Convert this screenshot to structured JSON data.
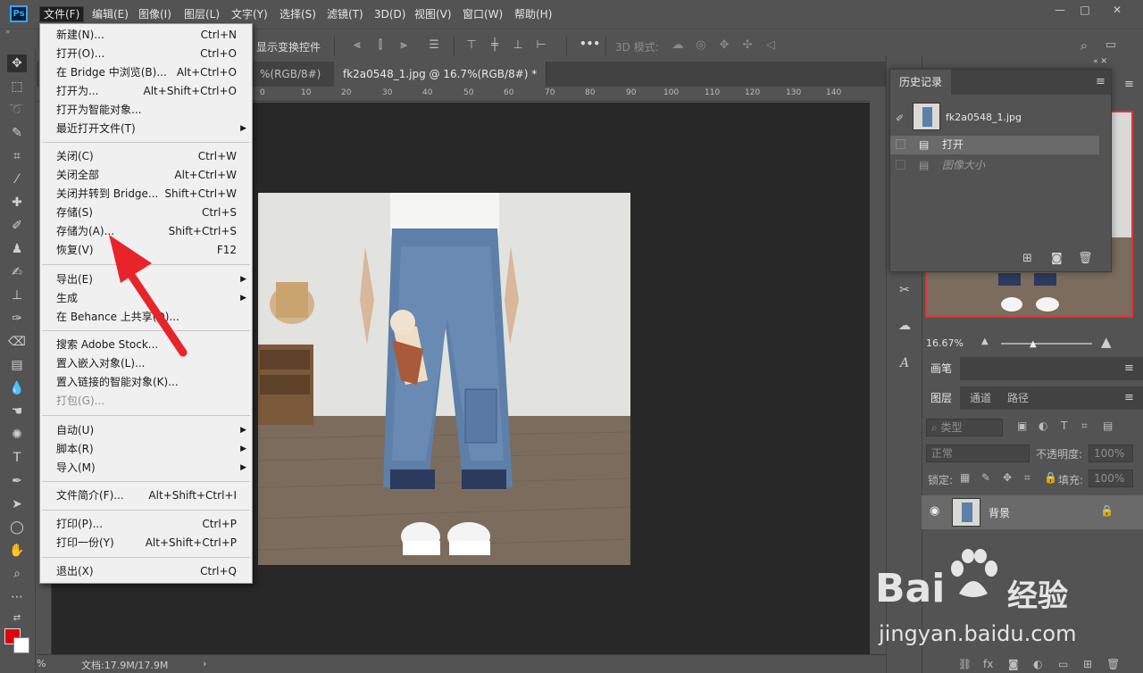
{
  "app": {
    "logo": "Ps"
  },
  "menubar": {
    "items": [
      "文件(F)",
      "编辑(E)",
      "图像(I)",
      "图层(L)",
      "文字(Y)",
      "选择(S)",
      "滤镜(T)",
      "3D(D)",
      "视图(V)",
      "窗口(W)",
      "帮助(H)"
    ],
    "window_buttons": [
      "—",
      "□",
      "✕"
    ]
  },
  "options_bar": {
    "show_transform_controls": "显示变换控件",
    "mode_3d": "3D 模式:",
    "more": "•••"
  },
  "tabs": [
    {
      "label": "%(RGB/8#)"
    },
    {
      "label": "fk2a0548_1.jpg @ 16.7%(RGB/8#) *",
      "close": "×"
    }
  ],
  "ruler": {
    "ticks": [
      "0",
      "10",
      "20",
      "30",
      "40",
      "50",
      "60",
      "70",
      "80",
      "90",
      "100",
      "110",
      "120",
      "130",
      "140"
    ]
  },
  "status": {
    "zoom": "%",
    "doc": "文档:17.9M/17.9M",
    "arrow": "›"
  },
  "file_menu": {
    "groups": [
      [
        {
          "label": "新建(N)...",
          "shortcut": "Ctrl+N"
        },
        {
          "label": "打开(O)...",
          "shortcut": "Ctrl+O"
        },
        {
          "label": "在 Bridge 中浏览(B)...",
          "shortcut": "Alt+Ctrl+O"
        },
        {
          "label": "打开为...",
          "shortcut": "Alt+Shift+Ctrl+O"
        },
        {
          "label": "打开为智能对象...",
          "shortcut": ""
        },
        {
          "label": "最近打开文件(T)",
          "shortcut": "",
          "submenu": true
        }
      ],
      [
        {
          "label": "关闭(C)",
          "shortcut": "Ctrl+W"
        },
        {
          "label": "关闭全部",
          "shortcut": "Alt+Ctrl+W"
        },
        {
          "label": "关闭并转到 Bridge...",
          "shortcut": "Shift+Ctrl+W"
        },
        {
          "label": "存储(S)",
          "shortcut": "Ctrl+S"
        },
        {
          "label": "存储为(A)...",
          "shortcut": "Shift+Ctrl+S"
        },
        {
          "label": "恢复(V)",
          "shortcut": "F12"
        }
      ],
      [
        {
          "label": "导出(E)",
          "shortcut": "",
          "submenu": true
        },
        {
          "label": "生成",
          "shortcut": "",
          "submenu": true
        },
        {
          "label": "在 Behance 上共享(D)...",
          "shortcut": ""
        }
      ],
      [
        {
          "label": "搜索 Adobe Stock...",
          "shortcut": ""
        },
        {
          "label": "置入嵌入对象(L)...",
          "shortcut": ""
        },
        {
          "label": "置入链接的智能对象(K)...",
          "shortcut": ""
        },
        {
          "label": "打包(G)...",
          "shortcut": "",
          "disabled": true
        }
      ],
      [
        {
          "label": "自动(U)",
          "shortcut": "",
          "submenu": true
        },
        {
          "label": "脚本(R)",
          "shortcut": "",
          "submenu": true
        },
        {
          "label": "导入(M)",
          "shortcut": "",
          "submenu": true
        }
      ],
      [
        {
          "label": "文件简介(F)...",
          "shortcut": "Alt+Shift+Ctrl+I"
        }
      ],
      [
        {
          "label": "打印(P)...",
          "shortcut": "Ctrl+P"
        },
        {
          "label": "打印一份(Y)",
          "shortcut": "Alt+Shift+Ctrl+P"
        }
      ],
      [
        {
          "label": "退出(X)",
          "shortcut": "Ctrl+Q"
        }
      ]
    ]
  },
  "history_panel": {
    "title": "历史记录",
    "snapshot": "fk2a0548_1.jpg",
    "states": [
      {
        "label": "打开",
        "selected": true
      },
      {
        "label": "图像大小",
        "dimmed": true
      }
    ]
  },
  "navigator": {
    "zoom": "16.67%"
  },
  "brush_panel": {
    "title": "画笔"
  },
  "layers_panel": {
    "tabs": [
      "图层",
      "通道",
      "路径"
    ],
    "filter_kind": "类型",
    "blend_mode": "正常",
    "opacity_label": "不透明度:",
    "opacity_value": "100%",
    "lock_label": "锁定:",
    "fill_label": "填充:",
    "fill_value": "100%",
    "layers": [
      {
        "name": "背景"
      }
    ]
  },
  "watermark": {
    "brand": "Bai",
    "brand2": "经验",
    "url": "jingyan.baidu.com"
  },
  "colors": {
    "accent": "#31a8ff",
    "foreground": "#e00000",
    "background": "#ffffff",
    "arrow": "#e8242b"
  }
}
